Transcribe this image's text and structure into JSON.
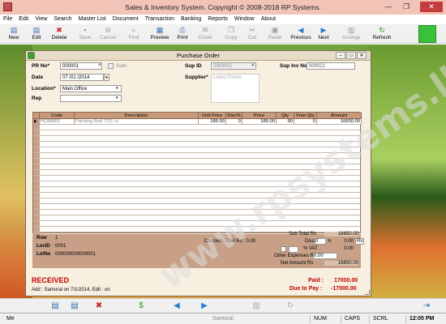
{
  "app": {
    "title": "Sales & Inventory System. Copyright © 2008-2018 RP Systems."
  },
  "menu": [
    "File",
    "Edit",
    "View",
    "Search",
    "Master List",
    "Document",
    "Transaction",
    "Banking",
    "Reports",
    "Window",
    "About"
  ],
  "toolbar": [
    {
      "label": "New",
      "icon": "new-document-icon",
      "enabled": true
    },
    {
      "label": "Edit",
      "icon": "edit-icon",
      "enabled": true
    },
    {
      "label": "Delete",
      "icon": "delete-icon",
      "enabled": true
    },
    {
      "label": "Save",
      "icon": "save-icon",
      "enabled": false
    },
    {
      "label": "Cancel",
      "icon": "cancel-icon",
      "enabled": false
    },
    {
      "label": "Find",
      "icon": "find-icon",
      "enabled": false
    },
    {
      "label": "Preview",
      "icon": "preview-icon",
      "enabled": true
    },
    {
      "label": "Print",
      "icon": "print-icon",
      "enabled": true
    },
    {
      "label": "Email",
      "icon": "email-icon",
      "enabled": false
    },
    {
      "label": "Copy",
      "icon": "copy-icon",
      "enabled": false
    },
    {
      "label": "Cut",
      "icon": "cut-icon",
      "enabled": false
    },
    {
      "label": "Paste",
      "icon": "paste-icon",
      "enabled": false
    },
    {
      "label": "Previous",
      "icon": "previous-icon",
      "enabled": true
    },
    {
      "label": "Next",
      "icon": "next-icon",
      "enabled": true
    },
    {
      "label": "Arrange",
      "icon": "arrange-icon",
      "enabled": false
    },
    {
      "label": "Refresh",
      "icon": "refresh-icon",
      "enabled": true
    }
  ],
  "window": {
    "title": "Purchase Order"
  },
  "form": {
    "pr_no_label": "PR No*",
    "pr_no": "000001",
    "auto_label": "Auto",
    "date_label": "Date",
    "date": "07 /01 /2014",
    "location_label": "Location*",
    "location": "Main Office",
    "rep_label": "Rep",
    "rep": "",
    "sup_id_label": "Sup ID",
    "sup_id": "SW0001",
    "supplier_label": "Supplier*",
    "supplier": "Latest Paints",
    "sup_inv_label": "Sup Inv No",
    "sup_inv": "000021"
  },
  "grid": {
    "headers": [
      "Code",
      "Description",
      "Unit Price",
      "Disc%",
      "Price",
      "Qty",
      "Free Qty",
      "Amount"
    ],
    "rows": [
      {
        "code": "PC00007",
        "description": "Painting Red 7/22 cc",
        "unit_price": "185.00",
        "disc": "0",
        "price": "185.00",
        "qty": "90",
        "free_qty": "0",
        "amount": "16650.00"
      }
    ]
  },
  "footer": {
    "row_label": "Row",
    "row": "1",
    "locid_label": "LocID",
    "locid": "0001",
    "lotno_label": "LotNo",
    "lotno": "000000000000001",
    "disc_total_label": "Discount Total Rs : 0.00",
    "sub_total_label": "Sub Total Rs",
    "sub_total": "16650.00",
    "disc_label": "Disc",
    "disc_pct": "0",
    "disc_amt": "0.00",
    "rs_label": "Rs",
    "vat_label": "% VAT",
    "vat_amt": "0.00",
    "other_label": "Other Expenses Rs",
    "other": "0.00",
    "net_label": "Net Amount Rs",
    "net": "16650.00"
  },
  "status_text": {
    "received": "RECEIVED",
    "paid_label": "Paid :",
    "paid": "17000.00",
    "due_label": "Due to Pay :",
    "due": "-17000.00",
    "added": "Add : Samurai on 7/1/2014, Edit : on"
  },
  "statusbar": {
    "left": "Me",
    "center": "Samurai",
    "num": "NUM",
    "caps": "CAPS",
    "scrl": "SCRL",
    "time": "12:05 PM"
  },
  "watermark": "www.rpsystems.lk",
  "colors": {
    "received": "#c00000",
    "grid_header": "#c99a7a",
    "window_bg": "#f7efe0"
  }
}
